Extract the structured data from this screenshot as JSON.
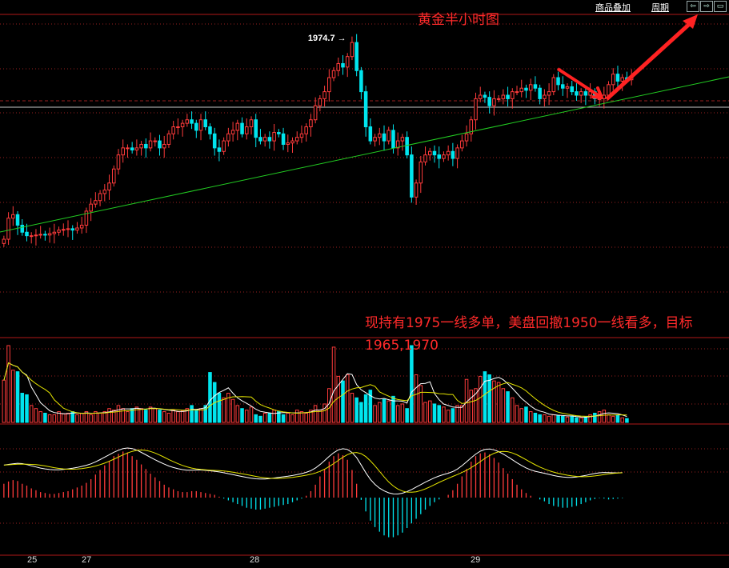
{
  "title": "黄金半小时图",
  "toolbar": {
    "overlay_label": "商品叠加",
    "period_label": "周期",
    "nav_prev_icon": "arrow-left-icon",
    "nav_next_icon": "arrow-right-icon",
    "nav_full_icon": "expand-icon"
  },
  "annotation": "现持有1975一线多单，美盘回撤1950一线看多，目标1965,1970",
  "colors": {
    "up": "#ff3b3b",
    "down": "#00e5ee",
    "border": "#b01818",
    "grid": "#9a1f1f",
    "trendline": "#22cc22",
    "dif": "#ffffff",
    "dea": "#e6e600",
    "annotation": "#ff2a2a"
  },
  "chart_data": [
    {
      "type": "candlestick",
      "title": "黄金半小时图",
      "x_tick_labels": [
        "25",
        "27",
        "28",
        "29"
      ],
      "ylim": [
        1932,
        1978
      ],
      "price_annotation": "1974.7",
      "close": [
        1946,
        1949,
        1949.5,
        1948,
        1947,
        1946.5,
        1946.5,
        1946.6,
        1946.7,
        1946.6,
        1946.8,
        1947,
        1947.3,
        1947.4,
        1947.5,
        1947.3,
        1947.6,
        1948,
        1950,
        1951,
        1951.5,
        1952.5,
        1953,
        1954,
        1956,
        1958,
        1959,
        1959,
        1958.7,
        1959,
        1959.5,
        1959,
        1960,
        1960,
        1959,
        1959.5,
        1961,
        1962,
        1962,
        1962.5,
        1963,
        1962.5,
        1961.5,
        1963,
        1962,
        1961,
        1959,
        1958.5,
        1960,
        1961,
        1961.5,
        1962.5,
        1961,
        1962,
        1963,
        1960.5,
        1960,
        1960.5,
        1960,
        1961.2,
        1961,
        1959.5,
        1959.7,
        1960,
        1960.5,
        1961,
        1962,
        1963,
        1965,
        1966,
        1967,
        1969,
        1970,
        1971,
        1970.5,
        1972,
        1974,
        1970,
        1967,
        1962,
        1960,
        1960.5,
        1961,
        1960,
        1961.5,
        1959,
        1960,
        1960.5,
        1958,
        1952,
        1954,
        1957,
        1958,
        1958.5,
        1958,
        1957.5,
        1958,
        1958.5,
        1957.5,
        1959,
        1960,
        1961,
        1963,
        1966,
        1966.5,
        1966.2,
        1965,
        1966,
        1966,
        1966.5,
        1966,
        1967,
        1967,
        1967.5,
        1967.2,
        1968,
        1967.5,
        1966,
        1966.5,
        1967,
        1969,
        1968,
        1967.5,
        1967.7,
        1967,
        1966.5,
        1967,
        1966.5,
        1967,
        1966,
        1966,
        1966.5,
        1968,
        1969.5,
        1968.5,
        1969,
        1968.7,
        1969
      ],
      "volume": [
        0.55,
        1.0,
        0.68,
        0.66,
        0.38,
        0.36,
        0.22,
        0.18,
        0.14,
        0.12,
        0.1,
        0.1,
        0.14,
        0.11,
        0.12,
        0.14,
        0.1,
        0.12,
        0.14,
        0.1,
        0.14,
        0.12,
        0.14,
        0.18,
        0.16,
        0.22,
        0.18,
        0.14,
        0.18,
        0.2,
        0.18,
        0.16,
        0.2,
        0.18,
        0.16,
        0.14,
        0.12,
        0.16,
        0.14,
        0.15,
        0.18,
        0.22,
        0.16,
        0.18,
        0.22,
        0.65,
        0.52,
        0.38,
        0.32,
        0.38,
        0.3,
        0.22,
        0.18,
        0.16,
        0.2,
        0.1,
        0.08,
        0.12,
        0.12,
        0.16,
        0.14,
        0.1,
        0.12,
        0.1,
        0.16,
        0.14,
        0.12,
        0.16,
        0.22,
        0.16,
        0.24,
        0.44,
        0.98,
        0.6,
        0.54,
        0.62,
        0.38,
        0.32,
        0.26,
        0.36,
        0.42,
        0.22,
        0.26,
        0.3,
        0.28,
        0.34,
        0.22,
        0.24,
        0.18,
        1.0,
        0.62,
        0.48,
        0.26,
        0.28,
        0.24,
        0.22,
        0.2,
        0.16,
        0.18,
        0.22,
        0.22,
        0.56,
        0.42,
        0.44,
        0.6,
        0.66,
        0.62,
        0.54,
        0.52,
        0.44,
        0.4,
        0.32,
        0.22,
        0.18,
        0.2,
        0.14,
        0.12,
        0.1,
        0.1,
        0.08,
        0.1,
        0.09,
        0.08,
        0.07,
        0.08,
        0.06,
        0.06,
        0.07,
        0.1,
        0.12,
        0.14,
        0.16,
        0.1,
        0.08,
        0.09,
        0.06,
        0.05
      ],
      "macd": [
        0.3,
        0.35,
        0.38,
        0.36,
        0.3,
        0.26,
        0.2,
        0.16,
        0.12,
        0.1,
        0.08,
        0.08,
        0.1,
        0.12,
        0.14,
        0.18,
        0.22,
        0.26,
        0.32,
        0.4,
        0.5,
        0.6,
        0.7,
        0.8,
        0.9,
        0.95,
        1.0,
        0.98,
        0.9,
        0.82,
        0.72,
        0.62,
        0.52,
        0.44,
        0.36,
        0.28,
        0.22,
        0.18,
        0.14,
        0.12,
        0.12,
        0.14,
        0.14,
        0.12,
        0.1,
        0.08,
        0.06,
        0.02,
        -0.02,
        -0.06,
        -0.1,
        -0.14,
        -0.18,
        -0.22,
        -0.24,
        -0.26,
        -0.26,
        -0.24,
        -0.22,
        -0.2,
        -0.18,
        -0.16,
        -0.14,
        -0.1,
        -0.06,
        -0.02,
        0.04,
        0.14,
        0.28,
        0.46,
        0.62,
        0.78,
        0.9,
        0.96,
        0.92,
        0.82,
        0.6,
        0.3,
        -0.05,
        -0.3,
        -0.5,
        -0.64,
        -0.74,
        -0.82,
        -0.86,
        -0.86,
        -0.82,
        -0.76,
        -0.66,
        -0.56,
        -0.46,
        -0.36,
        -0.26,
        -0.18,
        -0.1,
        -0.04,
        0.0,
        0.06,
        0.16,
        0.3,
        0.46,
        0.62,
        0.78,
        0.9,
        0.96,
        0.98,
        0.94,
        0.86,
        0.76,
        0.64,
        0.52,
        0.4,
        0.28,
        0.18,
        0.1,
        0.04,
        0.0,
        -0.04,
        -0.08,
        -0.14,
        -0.18,
        -0.2,
        -0.22,
        -0.22,
        -0.2,
        -0.18,
        -0.14,
        -0.1,
        -0.06,
        -0.03,
        -0.01,
        -0.02,
        -0.04,
        -0.03,
        -0.02,
        -0.01
      ]
    }
  ]
}
